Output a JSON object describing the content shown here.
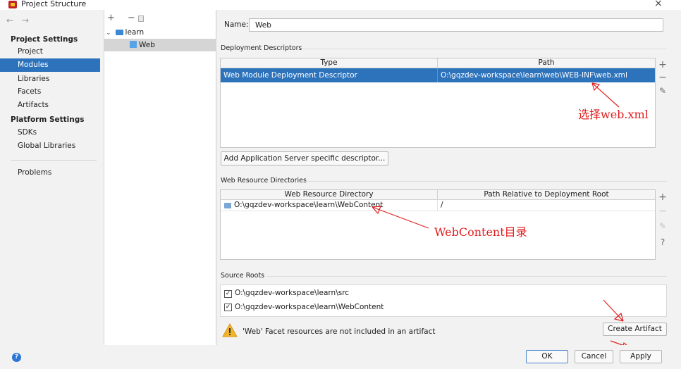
{
  "window": {
    "title": "Project Structure",
    "close_glyph": "×"
  },
  "nav": {
    "back_forward": "← →",
    "project_settings_heading": "Project Settings",
    "project_settings_items": [
      {
        "label": "Project",
        "selected": false
      },
      {
        "label": "Modules",
        "selected": true
      },
      {
        "label": "Libraries",
        "selected": false
      },
      {
        "label": "Facets",
        "selected": false
      },
      {
        "label": "Artifacts",
        "selected": false
      }
    ],
    "platform_settings_heading": "Platform Settings",
    "platform_settings_items": [
      {
        "label": "SDKs"
      },
      {
        "label": "Global Libraries"
      }
    ],
    "problems_label": "Problems"
  },
  "tree": {
    "toolbar": "+ −",
    "root": {
      "label": "learn",
      "expanded": true
    },
    "child": {
      "label": "Web",
      "selected": true
    }
  },
  "facet": {
    "name_label": "Name:",
    "name_value": "Web",
    "deployment_descriptors": {
      "title": "Deployment Descriptors",
      "columns": [
        "Type",
        "Path"
      ],
      "rows": [
        {
          "type": "Web Module Deployment Descriptor",
          "path": "O:\\gqzdev-workspace\\learn\\web\\WEB-INF\\web.xml",
          "selected": true
        }
      ],
      "add_server_descriptor_button": "Add Application Server specific descriptor..."
    },
    "web_resource_directories": {
      "title": "Web Resource Directories",
      "columns": [
        "Web Resource Directory",
        "Path Relative to Deployment Root"
      ],
      "rows": [
        {
          "directory": "O:\\gqzdev-workspace\\learn\\WebContent",
          "relative": "/"
        }
      ]
    },
    "source_roots": {
      "title": "Source Roots",
      "items": [
        {
          "path": "O:\\gqzdev-workspace\\learn\\src",
          "checked": true
        },
        {
          "path": "O:\\gqzdev-workspace\\learn\\WebContent",
          "checked": true
        }
      ]
    },
    "warning_text": "'Web' Facet resources are not included in an artifact",
    "create_artifact_button": "Create Artifact"
  },
  "annotations": {
    "web_xml": "选择web.xml",
    "webcontent": "WebContent目录"
  },
  "footer": {
    "ok": "OK",
    "cancel": "Cancel",
    "apply": "Apply",
    "help": "?"
  },
  "colors": {
    "selection_blue": "#2d73bc",
    "annotation_red": "#e02020",
    "warning_yellow": "#f0b429"
  }
}
